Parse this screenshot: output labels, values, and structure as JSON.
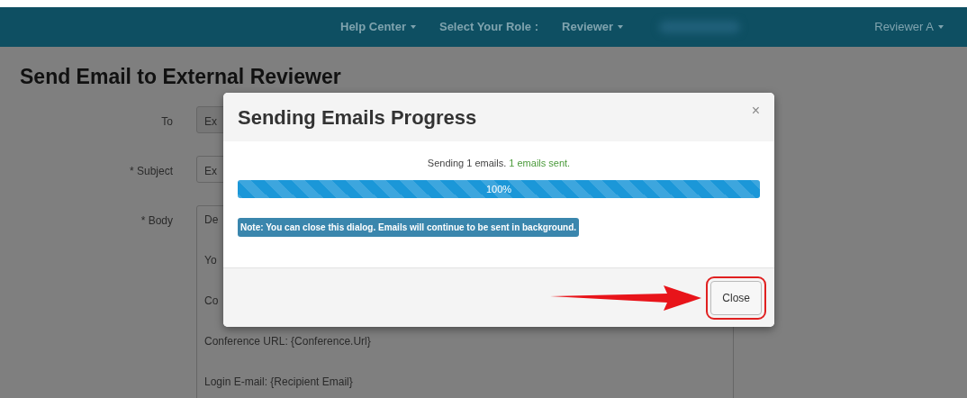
{
  "navbar": {
    "items": [
      {
        "label": "Help Center",
        "dropdown": true
      },
      {
        "label": "Select Your Role :",
        "dropdown": false
      },
      {
        "label": "Reviewer",
        "dropdown": true
      }
    ],
    "user_menu": {
      "label": "Reviewer A",
      "dropdown": true
    }
  },
  "page": {
    "title": "Send Email to External Reviewer",
    "form": [
      {
        "kind": "input",
        "label": "To",
        "value": "Ex"
      },
      {
        "kind": "input",
        "label": "* Subject",
        "value": "Ex"
      },
      {
        "kind": "textarea",
        "label": "* Body",
        "lines": [
          "De",
          "Yo",
          "Co",
          "Conference URL: {Conference.Url}",
          "Login E-mail: {Recipient Email}"
        ]
      }
    ]
  },
  "dialog": {
    "title": "Sending Emails Progress",
    "close_symbol": "×",
    "status": "Sending 1 emails.",
    "sent": "1 emails sent.",
    "progress": {
      "level": 1,
      "reading": "100%"
    },
    "note": "Note: You can close this dialog. Emails will continue to be sent in background.",
    "buttons": [
      {
        "label": "Close",
        "highlighted": true
      }
    ]
  }
}
